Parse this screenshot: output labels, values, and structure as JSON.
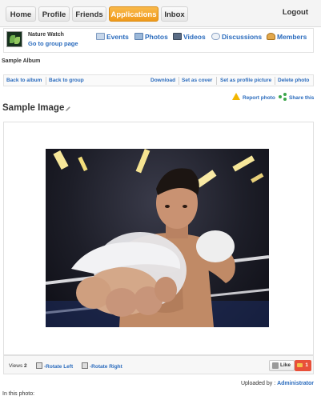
{
  "nav": {
    "tabs": [
      {
        "label": "Home"
      },
      {
        "label": "Profile"
      },
      {
        "label": "Friends"
      },
      {
        "label": "Applications"
      },
      {
        "label": "Inbox"
      }
    ],
    "logout": "Logout"
  },
  "group": {
    "name": "Nature Watch",
    "link": "Go to group page",
    "menu": [
      {
        "label": "Events",
        "icon": "events-icon"
      },
      {
        "label": "Photos",
        "icon": "photos-icon"
      },
      {
        "label": "Videos",
        "icon": "videos-icon"
      },
      {
        "label": "Discussions",
        "icon": "discussions-icon"
      },
      {
        "label": "Members",
        "icon": "members-icon"
      }
    ]
  },
  "album": {
    "title": "Sample Album"
  },
  "actions": {
    "back_album": "Back to album",
    "back_group": "Back to group",
    "download": "Download",
    "set_cover": "Set as cover",
    "set_profile": "Set as profile picture",
    "delete": "Delete photo"
  },
  "photo": {
    "title": "Sample Image",
    "report": "Report photo",
    "share": "Share this",
    "views_label": "Views",
    "views_count": "2",
    "rotate_left": "-Rotate Left",
    "rotate_right": "-Rotate Right",
    "like": "Like",
    "like_count": "1",
    "uploaded_label": "Uploaded by :",
    "uploader": "Administrator",
    "in_photo": "In this photo:"
  },
  "colors": {
    "accent": "#f09a1b",
    "link": "#2a6bbd"
  }
}
